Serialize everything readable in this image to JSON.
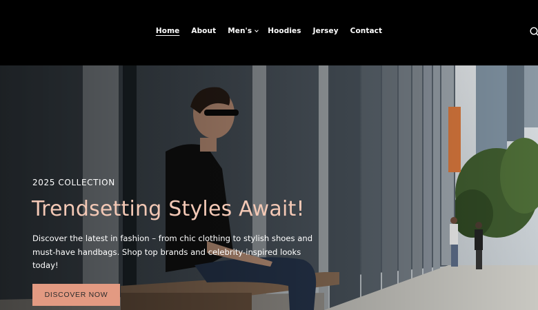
{
  "nav": {
    "items": [
      {
        "label": "Home",
        "active": true,
        "has_dropdown": false
      },
      {
        "label": "About",
        "active": false,
        "has_dropdown": false
      },
      {
        "label": "Men's",
        "active": false,
        "has_dropdown": true
      },
      {
        "label": "Hoodies",
        "active": false,
        "has_dropdown": false
      },
      {
        "label": "Jersey",
        "active": false,
        "has_dropdown": false
      },
      {
        "label": "Contact",
        "active": false,
        "has_dropdown": false
      }
    ],
    "search_icon": "search-icon",
    "dropdown_icon": "chevron-down-icon"
  },
  "hero": {
    "eyebrow": "2025 COLLECTION",
    "headline": "Trendsetting Styles Await!",
    "description": "Discover the latest in fashion – from chic clothing to stylish shoes and must-have handbags. Shop top brands and celebrity-inspired looks today!",
    "cta_label": "DISCOVER NOW"
  },
  "colors": {
    "header_bg": "#000000",
    "headline": "#f3c8b5",
    "cta_bg": "#e39a82",
    "text": "#ffffff"
  }
}
